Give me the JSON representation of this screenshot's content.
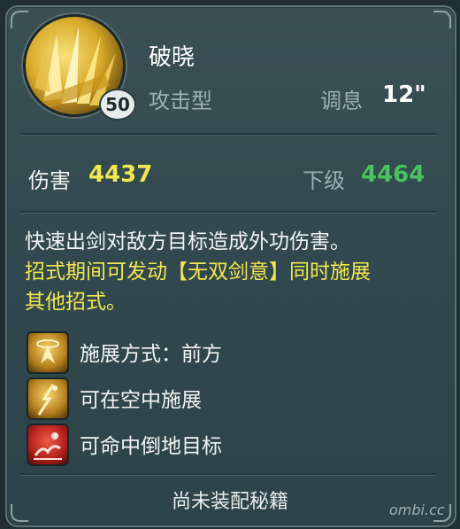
{
  "skill": {
    "name": "破晓",
    "level": "50",
    "type": "攻击型",
    "cooldown_label": "调息",
    "cooldown_value": "12\""
  },
  "stats": {
    "damage_label": "伤害",
    "damage_value": "4437",
    "next_label": "下级",
    "next_value": "4464"
  },
  "description": {
    "line1": "快速出剑对敌方目标造成外功伤害。",
    "line2": "招式期间可发动【无双剑意】同时施展",
    "line3": "其他招式。"
  },
  "features": [
    {
      "icon": "forward-cast-icon",
      "text": "施展方式：前方"
    },
    {
      "icon": "air-cast-icon",
      "text": "可在空中施展"
    },
    {
      "icon": "knockdown-hit-icon",
      "text": "可命中倒地目标"
    }
  ],
  "secret_manual": "尚未装配秘籍",
  "watermark": "ombi.cc",
  "colors": {
    "highlight_yellow": "#f3e74e",
    "next_green": "#46c35c",
    "muted_text": "#9cb0b2"
  }
}
